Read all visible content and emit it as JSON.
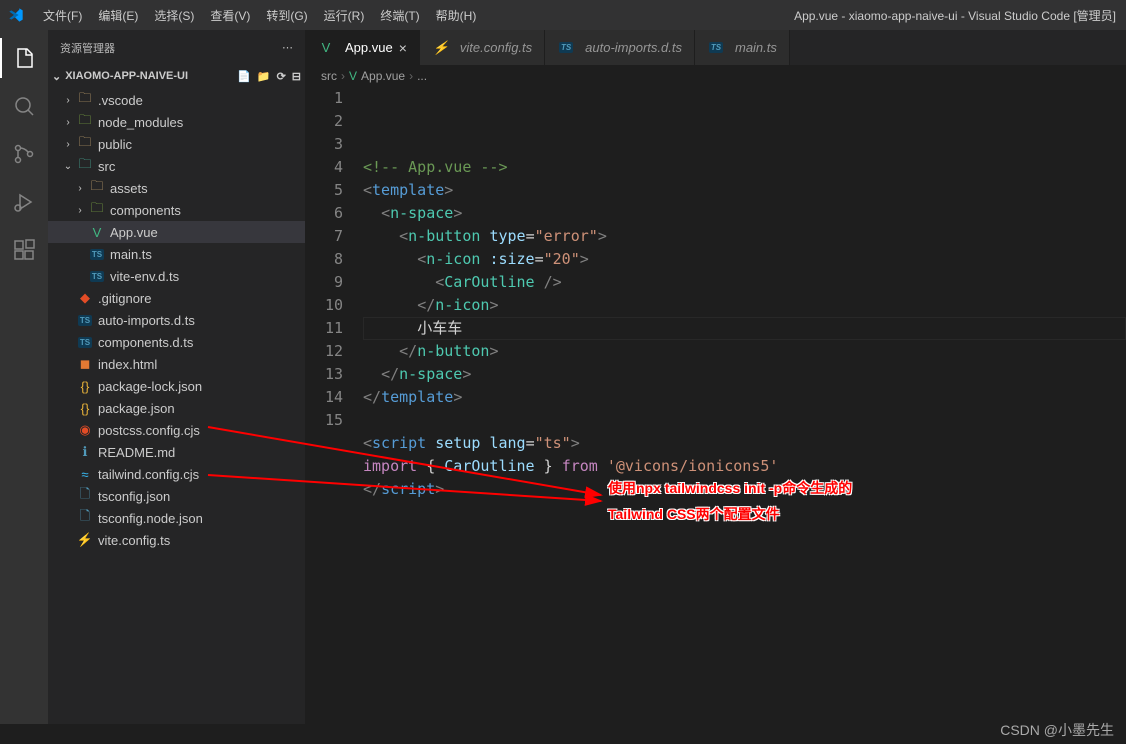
{
  "title": "App.vue - xiaomo-app-naive-ui - Visual Studio Code [管理员]",
  "menu": [
    "文件(F)",
    "编辑(E)",
    "选择(S)",
    "查看(V)",
    "转到(G)",
    "运行(R)",
    "终端(T)",
    "帮助(H)"
  ],
  "sidebar": {
    "title": "资源管理器",
    "more": "⋯",
    "project": "XIAOMO-APP-NAIVE-UI",
    "tree": [
      {
        "indent": 1,
        "chev": ">",
        "icon": "folder",
        "label": ".vscode"
      },
      {
        "indent": 1,
        "chev": ">",
        "icon": "folder-green",
        "label": "node_modules"
      },
      {
        "indent": 1,
        "chev": ">",
        "icon": "folder",
        "label": "public"
      },
      {
        "indent": 1,
        "chev": "v",
        "icon": "folder-teal",
        "label": "src"
      },
      {
        "indent": 2,
        "chev": ">",
        "icon": "folder",
        "label": "assets"
      },
      {
        "indent": 2,
        "chev": ">",
        "icon": "folder-green",
        "label": "components"
      },
      {
        "indent": 2,
        "chev": "",
        "icon": "vue",
        "label": "App.vue",
        "active": true
      },
      {
        "indent": 2,
        "chev": "",
        "icon": "ts",
        "label": "main.ts"
      },
      {
        "indent": 2,
        "chev": "",
        "icon": "ts",
        "label": "vite-env.d.ts"
      },
      {
        "indent": 1,
        "chev": "",
        "icon": "git",
        "label": ".gitignore"
      },
      {
        "indent": 1,
        "chev": "",
        "icon": "ts",
        "label": "auto-imports.d.ts"
      },
      {
        "indent": 1,
        "chev": "",
        "icon": "ts",
        "label": "components.d.ts"
      },
      {
        "indent": 1,
        "chev": "",
        "icon": "html",
        "label": "index.html"
      },
      {
        "indent": 1,
        "chev": "",
        "icon": "json",
        "label": "package-lock.json"
      },
      {
        "indent": 1,
        "chev": "",
        "icon": "json",
        "label": "package.json"
      },
      {
        "indent": 1,
        "chev": "",
        "icon": "postcss",
        "label": "postcss.config.cjs"
      },
      {
        "indent": 1,
        "chev": "",
        "icon": "md",
        "label": "README.md"
      },
      {
        "indent": 1,
        "chev": "",
        "icon": "tailwind",
        "label": "tailwind.config.cjs"
      },
      {
        "indent": 1,
        "chev": "",
        "icon": "json-blue",
        "label": "tsconfig.json"
      },
      {
        "indent": 1,
        "chev": "",
        "icon": "json-blue",
        "label": "tsconfig.node.json"
      },
      {
        "indent": 1,
        "chev": "",
        "icon": "js",
        "label": "vite.config.ts"
      }
    ]
  },
  "tabs": [
    {
      "icon": "vue",
      "label": "App.vue",
      "active": true,
      "close": true
    },
    {
      "icon": "js",
      "label": "vite.config.ts"
    },
    {
      "icon": "ts",
      "label": "auto-imports.d.ts"
    },
    {
      "icon": "ts",
      "label": "main.ts"
    }
  ],
  "breadcrumb": [
    "src",
    "App.vue",
    "..."
  ],
  "code": {
    "lines": 15,
    "content": [
      {
        "n": 1,
        "html": "<span class='t-comment'>&lt;!-- App.vue --&gt;</span>"
      },
      {
        "n": 2,
        "html": "<span class='t-tag'>&lt;</span><span class='t-el'>template</span><span class='t-tag'>&gt;</span>"
      },
      {
        "n": 3,
        "html": "  <span class='t-tag'>&lt;</span><span class='t-comp'>n-space</span><span class='t-tag'>&gt;</span>"
      },
      {
        "n": 4,
        "html": "    <span class='t-tag'>&lt;</span><span class='t-comp'>n-button</span> <span class='t-attr'>type</span><span class='t-txt'>=</span><span class='t-str'>\"error\"</span><span class='t-tag'>&gt;</span>"
      },
      {
        "n": 5,
        "html": "      <span class='t-tag'>&lt;</span><span class='t-comp'>n-icon</span> <span class='t-attr'>:size</span><span class='t-txt'>=</span><span class='t-str'>\"20\"</span><span class='t-tag'>&gt;</span>"
      },
      {
        "n": 6,
        "html": "        <span class='t-tag'>&lt;</span><span class='t-comp'>CarOutline</span> <span class='t-tag'>/&gt;</span>"
      },
      {
        "n": 7,
        "html": "      <span class='t-tag'>&lt;/</span><span class='t-comp'>n-icon</span><span class='t-tag'>&gt;</span>"
      },
      {
        "n": 8,
        "html": "      <span class='t-txt'>小车车</span>"
      },
      {
        "n": 9,
        "html": "    <span class='t-tag'>&lt;/</span><span class='t-comp'>n-button</span><span class='t-tag'>&gt;</span>"
      },
      {
        "n": 10,
        "html": "  <span class='t-tag'>&lt;/</span><span class='t-comp'>n-space</span><span class='t-tag'>&gt;</span>"
      },
      {
        "n": 11,
        "html": "<span class='t-tag'>&lt;/</span><span class='t-el'>template</span><span class='t-tag'>&gt;</span>"
      },
      {
        "n": 12,
        "html": ""
      },
      {
        "n": 13,
        "html": "<span class='t-tag'>&lt;</span><span class='t-el'>script</span> <span class='t-attr'>setup</span> <span class='t-attr'>lang</span><span class='t-txt'>=</span><span class='t-str'>\"ts\"</span><span class='t-tag'>&gt;</span>"
      },
      {
        "n": 14,
        "html": "<span class='t-kw'>import</span> <span class='t-txt'>{ </span><span class='t-attr'>CarOutline</span><span class='t-txt'> } </span><span class='t-kw'>from</span> <span class='t-str'>'@vicons/ionicons5'</span>"
      },
      {
        "n": 15,
        "html": "<span class='t-tag'>&lt;/</span><span class='t-el'>script</span><span class='t-tag'>&gt;</span>"
      }
    ]
  },
  "annotation": {
    "line1": "使用npx tailwindcss init -p命令生成的",
    "line2": "Tailwind CSS两个配置文件"
  },
  "watermark": "CSDN @小墨先生"
}
